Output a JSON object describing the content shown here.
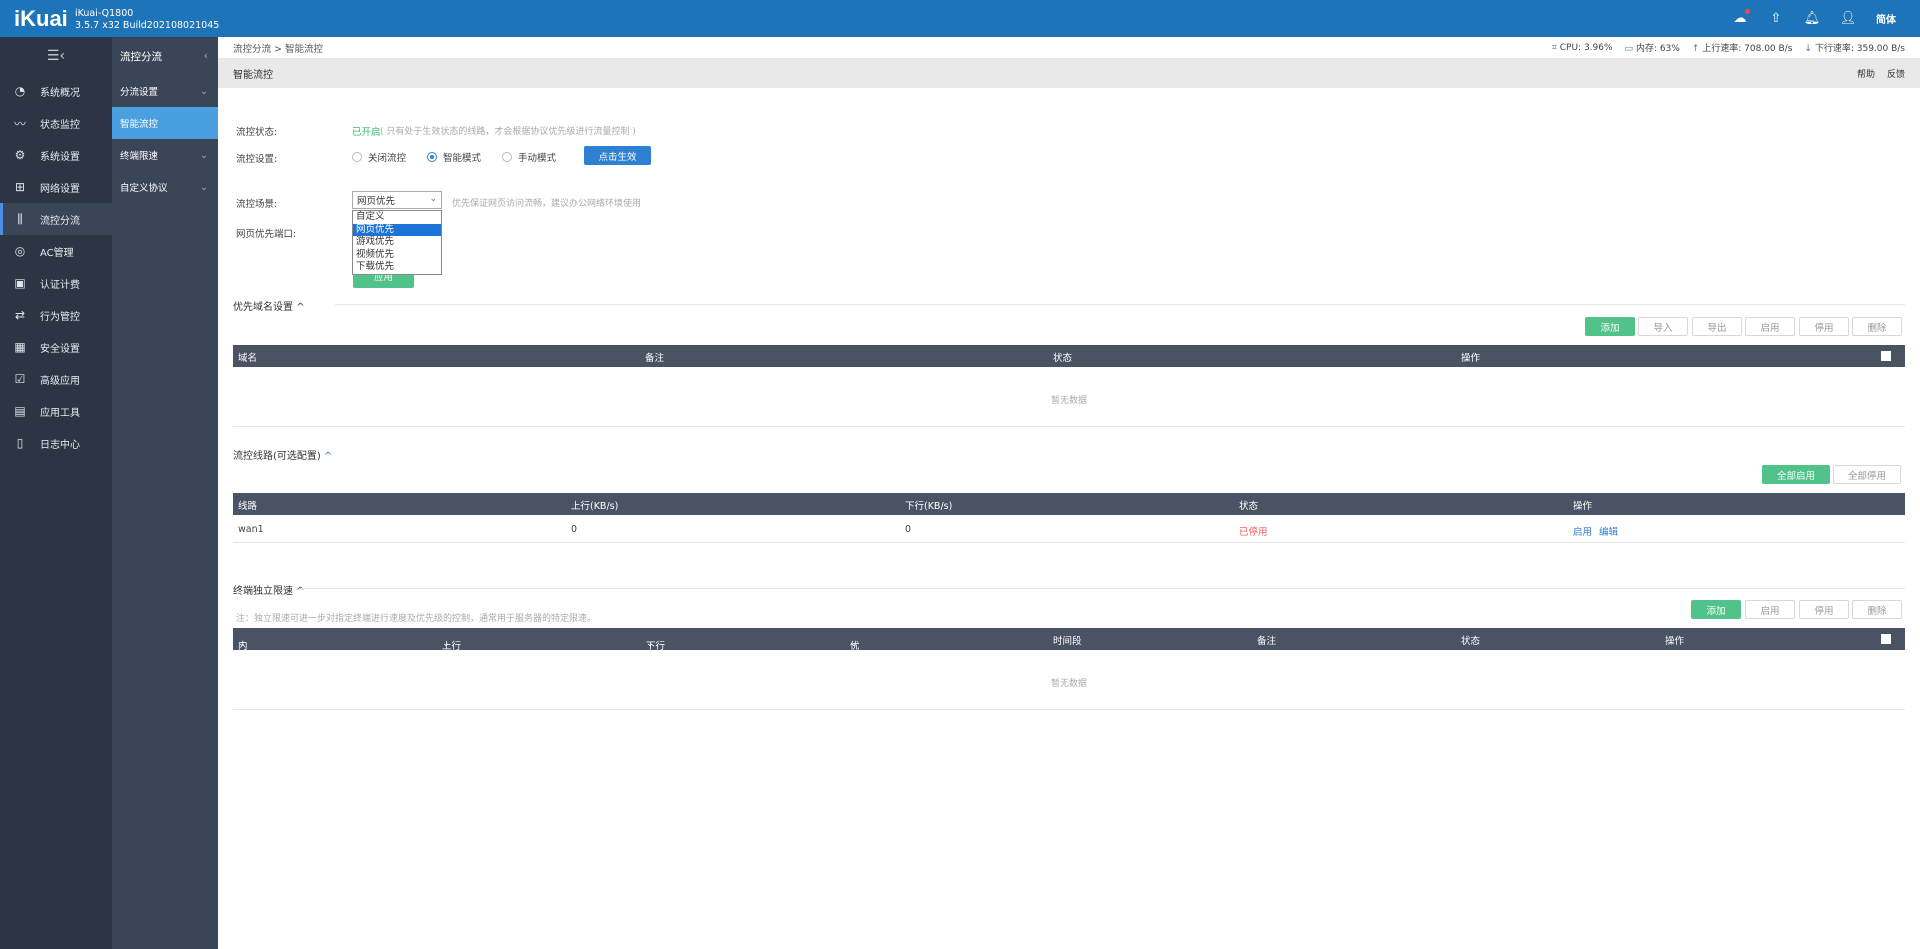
{
  "header": {
    "logo": "iKuai",
    "model": "iKuai-Q1800",
    "build": "3.5.7 x32 Build202108021045",
    "lang": "简体"
  },
  "sidebar": {
    "items": [
      {
        "label": "系统概况",
        "icon": "gauge-icon"
      },
      {
        "label": "状态监控",
        "icon": "monitor-icon"
      },
      {
        "label": "系统设置",
        "icon": "gear-icon"
      },
      {
        "label": "网络设置",
        "icon": "network-icon"
      },
      {
        "label": "流控分流",
        "icon": "sliders-icon",
        "active": true
      },
      {
        "label": "AC管理",
        "icon": "wifi-icon"
      },
      {
        "label": "认证计费",
        "icon": "id-card-icon"
      },
      {
        "label": "行为管控",
        "icon": "swap-icon"
      },
      {
        "label": "安全设置",
        "icon": "firewall-icon"
      },
      {
        "label": "高级应用",
        "icon": "check-box-icon"
      },
      {
        "label": "应用工具",
        "icon": "apps-icon"
      },
      {
        "label": "日志中心",
        "icon": "file-icon"
      }
    ]
  },
  "subbar": {
    "title": "流控分流",
    "items": [
      {
        "label": "分流设置",
        "expandable": true
      },
      {
        "label": "智能流控",
        "active": true
      },
      {
        "label": "终端限速",
        "expandable": true
      },
      {
        "label": "自定义协议",
        "expandable": true
      }
    ]
  },
  "crumb": {
    "path": "流控分流 > 智能流控",
    "cpu": "CPU: 3.96%",
    "mem": "内存: 63%",
    "up": "上行速率: 708.00 B/s",
    "down": "下行速率: 359.00 B/s"
  },
  "title": {
    "text": "智能流控",
    "help": "帮助",
    "feedback": "反馈"
  },
  "form": {
    "status_label": "流控状态:",
    "status_value": "已开启",
    "status_hint": "( 只有处于生效状态的线路，才会根据协议优先级进行流量控制 )",
    "setting_label": "流控设置:",
    "opt_off": "关闭流控",
    "opt_smart": "智能模式",
    "opt_manual": "手动模式",
    "apply_effect": "点击生效",
    "scene_label": "流控场景:",
    "scene_value": "网页优先",
    "scene_hint": "优先保证网页访问流畅，建议办公网络环境使用",
    "scene_options": [
      "自定义",
      "网页优先",
      "游戏优先",
      "视频优先",
      "下载优先"
    ],
    "port_label": "网页优先端口:",
    "apply": "应用"
  },
  "domain_section": {
    "title": "优先域名设置",
    "buttons": {
      "add": "添加",
      "import": "导入",
      "export": "导出",
      "enable": "启用",
      "disable": "停用",
      "delete": "删除"
    },
    "columns": [
      "域名",
      "备注",
      "状态",
      "操作"
    ],
    "empty": "暂无数据"
  },
  "line_section": {
    "title": "流控线路(可选配置)",
    "buttons": {
      "enable_all": "全部启用",
      "disable_all": "全部停用"
    },
    "columns": [
      "线路",
      "上行(KB/s)",
      "下行(KB/s)",
      "状态",
      "操作"
    ],
    "rows": [
      {
        "line": "wan1",
        "up": "0",
        "down": "0",
        "status": "已停用",
        "act_enable": "启用",
        "act_edit": "编辑"
      }
    ]
  },
  "terminal_section": {
    "title": "终端独立限速",
    "note": "注：独立限速可进一步对指定终端进行速度及优先级的控制，通常用于服务器的特定限速。",
    "buttons": {
      "add": "添加",
      "enable": "启用",
      "disable": "停用",
      "delete": "删除"
    },
    "columns": [
      "内网IP",
      "上行(KB/s)",
      "下行(KB/s)",
      "优先级",
      "时间段",
      "备注",
      "状态",
      "操作"
    ],
    "empty": "暂无数据"
  },
  "colors": {
    "accent": "#1e74b9",
    "green": "#52c28b",
    "sidebar": "#2b3543",
    "subbar": "#3a4657",
    "active_sub": "#4a9fe0",
    "table_head": "#4a5363"
  }
}
